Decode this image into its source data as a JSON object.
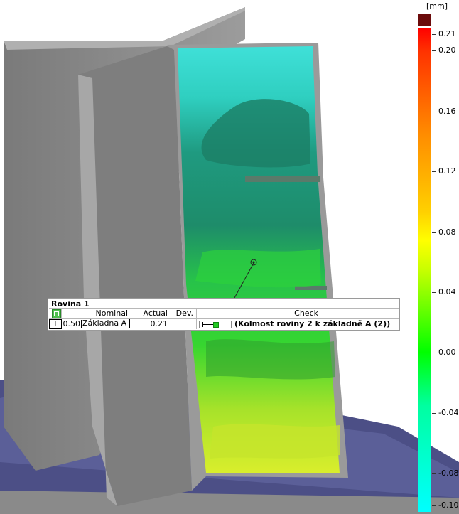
{
  "callout": {
    "title": "Rovina 1",
    "headers": {
      "nominal": "Nominal",
      "actual": "Actual",
      "dev": "Dev.",
      "check": "Check"
    },
    "row": {
      "symbol": "⊥",
      "tolerance": "0.50",
      "datum": "Základna A",
      "actual": "0.21",
      "dev": "",
      "check_text": "(Kolmost roviny 2 k základně A (2))",
      "check_fill": 0.42
    }
  },
  "scale": {
    "unit": "[mm]",
    "labels": [
      "0.21",
      "0.20",
      "0.16",
      "0.12",
      "0.08",
      "0.04",
      "0.00",
      "-0.04",
      "-0.08",
      "-0.10"
    ],
    "top_color": "#6b0b0b"
  },
  "colors": {
    "part_gray": "#8e8e8e",
    "base_blue": "#4c4f86",
    "pass_green": "#22cc22"
  }
}
